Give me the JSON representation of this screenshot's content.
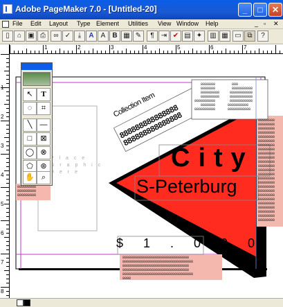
{
  "window": {
    "title": "Adobe PageMaker 7.0 - [Untitled-20]",
    "controls": {
      "minimize": "_",
      "maximize": "□",
      "close": "✕"
    }
  },
  "menubar": {
    "items": [
      "File",
      "Edit",
      "Layout",
      "Type",
      "Element",
      "Utilities",
      "View",
      "Window",
      "Help"
    ],
    "doc_controls": {
      "minimize": "_",
      "restore": "▫",
      "close": "✕"
    }
  },
  "toolbar": {
    "buttons": [
      "new-doc-icon",
      "open-folder-icon",
      "save-icon",
      "print-icon",
      "find-icon",
      "spell-check-icon",
      "place-icon",
      "character-icon",
      "text-size-icon",
      "bold-icon",
      "italic-icon",
      "paragraph-icon",
      "indent-icon",
      "align-icon",
      "styles-icon",
      "colors-icon",
      "links-icon",
      "help-icon"
    ]
  },
  "rulers": {
    "h_numbers": [
      "1",
      "2",
      "3",
      "4",
      "5",
      "6",
      "7"
    ],
    "v_numbers": [
      "1",
      "2",
      "3",
      "4",
      "5",
      "6",
      "7",
      "8"
    ]
  },
  "toolbox": {
    "tools": [
      {
        "name": "pointer-tool-icon",
        "glyph": "↖"
      },
      {
        "name": "text-tool-icon",
        "glyph": "T"
      },
      {
        "name": "rotate-tool-icon",
        "glyph": "◌"
      },
      {
        "name": "crop-tool-icon",
        "glyph": "⌗"
      },
      {
        "name": "line-tool-icon",
        "glyph": "╲"
      },
      {
        "name": "constrained-line-tool-icon",
        "glyph": "—"
      },
      {
        "name": "rectangle-tool-icon",
        "glyph": "□"
      },
      {
        "name": "rectangle-frame-tool-icon",
        "glyph": "⊠"
      },
      {
        "name": "ellipse-tool-icon",
        "glyph": "◯"
      },
      {
        "name": "ellipse-frame-tool-icon",
        "glyph": "⊗"
      },
      {
        "name": "polygon-tool-icon",
        "glyph": "⬠"
      },
      {
        "name": "polygon-frame-tool-icon",
        "glyph": "⊛"
      },
      {
        "name": "hand-tool-icon",
        "glyph": "✋"
      },
      {
        "name": "zoom-tool-icon",
        "glyph": "🔍"
      }
    ]
  },
  "document": {
    "placeholder_lines": [
      "P l a c e",
      "G r a p h i c",
      "H e r e"
    ],
    "rotated_caption": "Collection Item",
    "city": "City",
    "city_sub": "S-Peterburg",
    "price": "$ 1 . 0 0 0",
    "colors": {
      "red": "#ff2b1f",
      "black": "#000000",
      "magenta_guide": "#c03cc0",
      "pink_box": "#f5b8ae",
      "blue_guide": "#6e8fd8"
    }
  }
}
